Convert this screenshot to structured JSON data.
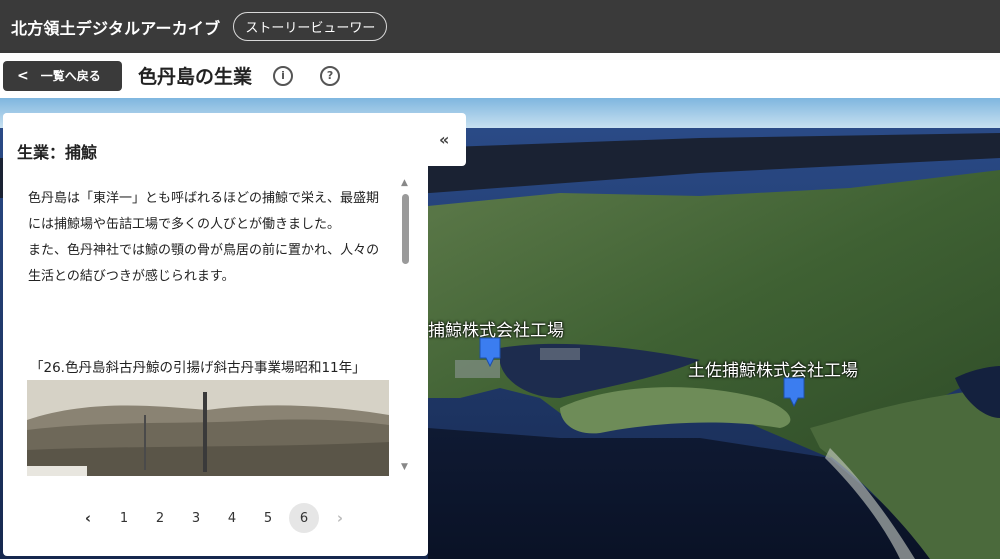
{
  "header": {
    "app_title": "北方領土デジタルアーカイブ",
    "story_viewer_label": "ストーリービューワー"
  },
  "subheader": {
    "back_label": "一覧へ戻る",
    "page_title": "色丹島の生業",
    "info_icon_glyph": "i",
    "help_icon_glyph": "?"
  },
  "panel": {
    "title": "生業：捕鯨",
    "collapse_glyph": "«",
    "paragraph1": "色丹島は「東洋一」とも呼ばれるほどの捕鯨で栄え、最盛期には捕鯨場や缶詰工場で多くの人びとが働きました。",
    "paragraph2": "また、色丹神社では鯨の顎の骨が鳥居の前に置かれ、人々の生活との結びつきが感じられます。",
    "caption": "「26.色丹島斜古丹鯨の引揚げ斜古丹事業場昭和11年」"
  },
  "pagination": {
    "prev": "‹",
    "pages": [
      "1",
      "2",
      "3",
      "4",
      "5",
      "6"
    ],
    "active_page": "6",
    "next": "›"
  },
  "map": {
    "label_left": "捕鯨株式会社工場",
    "label_right": "土佐捕鯨株式会社工場",
    "pin_color": "#3b7df0"
  }
}
